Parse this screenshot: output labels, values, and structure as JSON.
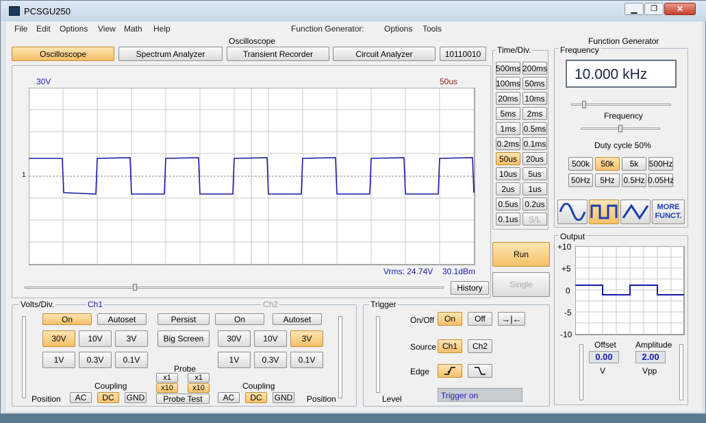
{
  "window": {
    "title": "PCSGU250"
  },
  "menu": {
    "items": [
      "File",
      "Edit",
      "Options",
      "View",
      "Math",
      "Help"
    ],
    "fg_label": "Function Generator:",
    "fg_items": [
      "Options",
      "Tools"
    ]
  },
  "scope": {
    "group_title": "Oscilloscope",
    "tabs": [
      "Oscilloscope",
      "Spectrum Analyzer",
      "Transient Recorder",
      "Circuit Analyzer",
      "10110010"
    ],
    "active_tab": 0,
    "volts_label": "30V",
    "time_label": "50us",
    "marker": "1",
    "vrms": "Vrms: 24.74V",
    "dbm": "30.1dBm",
    "history": "History"
  },
  "timediv": {
    "title": "Time/Div.",
    "buttons": [
      "500ms",
      "200ms",
      "100ms",
      "50ms",
      "20ms",
      "10ms",
      "5ms",
      "2ms",
      "1ms",
      "0.5ms",
      "0.2ms",
      "0.1ms",
      "50us",
      "20us",
      "10us",
      "5us",
      "2us",
      "1us",
      "0.5us",
      "0.2us",
      "0.1us",
      "S/L"
    ],
    "selected": "50us",
    "disabled": "S/L",
    "run": "Run",
    "single": "Single"
  },
  "volts": {
    "title": "Volts/Div.",
    "ch1": "Ch1",
    "ch2": "Ch2",
    "on": "On",
    "autoset": "Autoset",
    "persist": "Persist",
    "big_screen": "Big Screen",
    "v30": "30V",
    "v10": "10V",
    "v3": "3V",
    "v1": "1V",
    "v03": "0.3V",
    "v01": "0.1V",
    "probe": "Probe",
    "x1": "x1",
    "x10": "x10",
    "probe_test": "Probe Test",
    "coupling": "Coupling",
    "ac": "AC",
    "dc": "DC",
    "gnd": "GND",
    "position": "Position"
  },
  "trigger": {
    "title": "Trigger",
    "onoff": "On/Off",
    "on": "On",
    "off": "Off",
    "source": "Source",
    "ch1": "Ch1",
    "ch2": "Ch2",
    "edge": "Edge",
    "level": "Level",
    "status": "Trigger on"
  },
  "fg": {
    "title": "Function Generator",
    "freq_group": "Frequency",
    "freq_value": "10.000 kHz",
    "freq_slider_label": "Frequency",
    "duty": "Duty cycle 50%",
    "ranges": [
      "500k",
      "50k",
      "5k",
      "500Hz",
      "50Hz",
      "5Hz",
      "0.5Hz",
      "0.05Hz"
    ],
    "selected_range": "50k",
    "more": "MORE\nFUNCT.",
    "output": "Output",
    "y_ticks": [
      "+10",
      "+5",
      "0",
      "-5",
      "-10"
    ],
    "offset_label": "Offset",
    "offset_value": "0.00",
    "offset_unit": "V",
    "amp_label": "Amplitude",
    "amp_value": "2.00",
    "amp_unit": "Vpp"
  },
  "colors": {
    "trace": "#1a1aa8",
    "accent": "#f6c06a"
  }
}
